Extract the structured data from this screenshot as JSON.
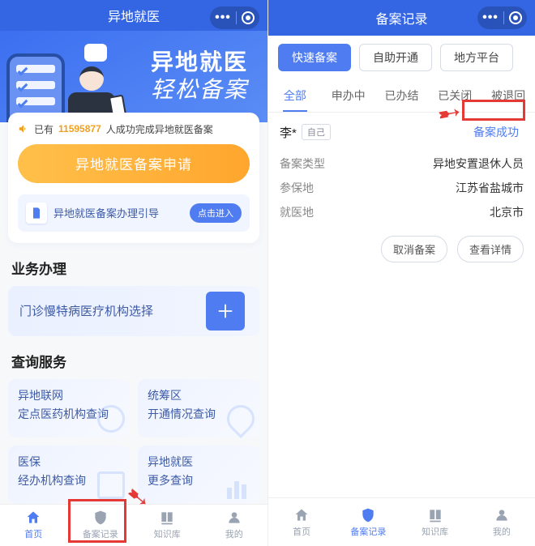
{
  "left": {
    "titlebar": {
      "title": "异地就医"
    },
    "hero": {
      "line1": "异地就医",
      "line2": "轻松备案"
    },
    "announce": {
      "prefix": "已有",
      "count": "11595877",
      "suffix": "人成功完成异地就医备案"
    },
    "applyButton": "异地就医备案申请",
    "guide": {
      "text": "异地就医备案办理引导",
      "enter": "点击进入"
    },
    "section_business": "业务办理",
    "businessCard": "门诊慢特病医疗机构选择",
    "section_query": "查询服务",
    "queryCards": [
      {
        "t1": "异地联网",
        "t2": "定点医药机构查询"
      },
      {
        "t1": "统筹区",
        "t2": "开通情况查询"
      },
      {
        "t1": "医保",
        "t2": "经办机构查询"
      },
      {
        "t1": "异地就医",
        "t2": "更多查询"
      }
    ],
    "tabs": [
      {
        "label": "首页"
      },
      {
        "label": "备案记录"
      },
      {
        "label": "知识库"
      },
      {
        "label": "我的"
      }
    ]
  },
  "right": {
    "titlebar": {
      "title": "备案记录"
    },
    "filters": [
      {
        "label": "快速备案",
        "active": true
      },
      {
        "label": "自助开通",
        "active": false
      },
      {
        "label": "地方平台",
        "active": false
      }
    ],
    "statusTabs": [
      {
        "label": "全部",
        "active": true
      },
      {
        "label": "申办中"
      },
      {
        "label": "已办结"
      },
      {
        "label": "已关闭"
      },
      {
        "label": "被退回"
      }
    ],
    "record": {
      "name": "李*",
      "selfTag": "自己",
      "status": "备案成功",
      "rows": [
        {
          "k": "备案类型",
          "v": "异地安置退休人员"
        },
        {
          "k": "参保地",
          "v": "江苏省盐城市"
        },
        {
          "k": "就医地",
          "v": "北京市"
        }
      ],
      "actions": {
        "cancel": "取消备案",
        "detail": "查看详情"
      }
    },
    "tabs": [
      {
        "label": "首页"
      },
      {
        "label": "备案记录"
      },
      {
        "label": "知识库"
      },
      {
        "label": "我的"
      }
    ]
  }
}
